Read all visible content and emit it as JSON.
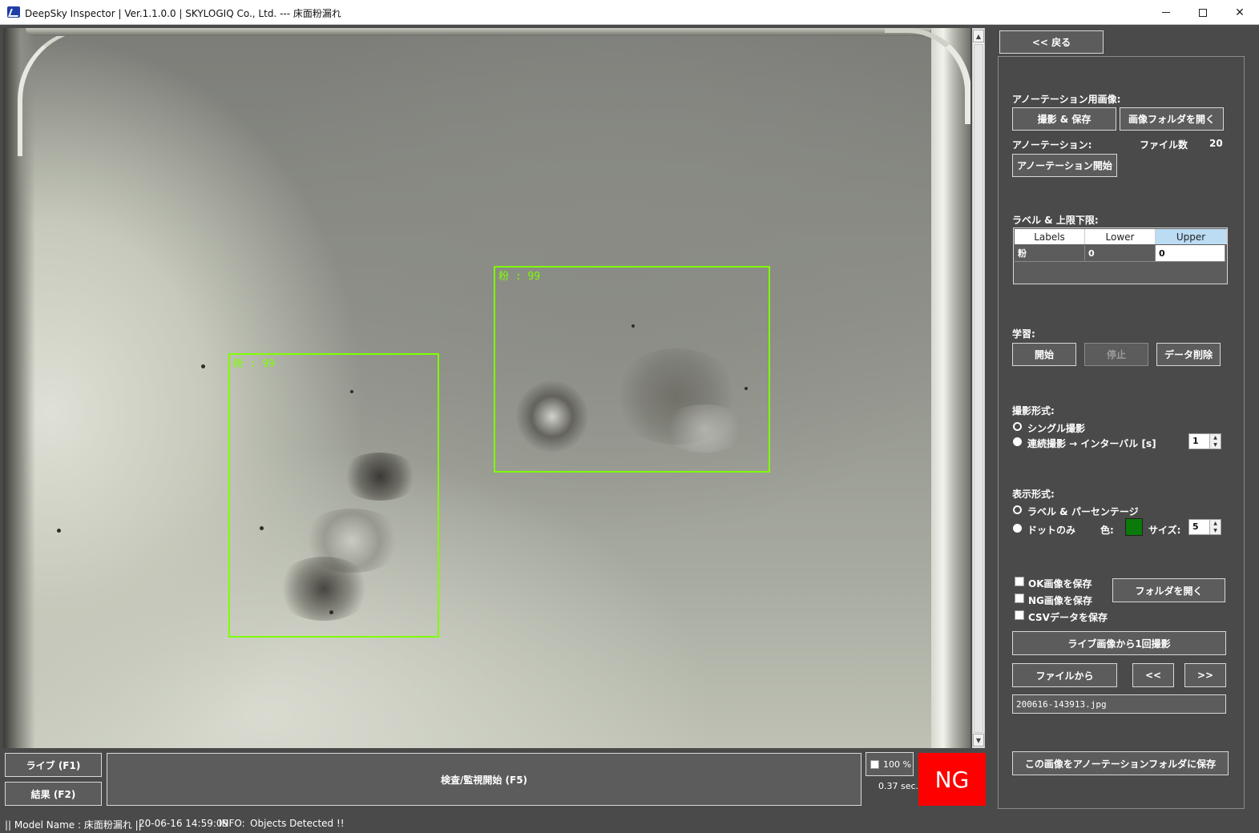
{
  "window": {
    "title": "DeepSky Inspector | Ver.1.1.0.0 | SKYLOGIQ Co., Ltd. --- 床面粉漏れ",
    "min_icon": "minimize-icon",
    "max_icon": "maximize-icon",
    "close_label": "✕"
  },
  "detections": [
    {
      "label": "粉 : 99"
    },
    {
      "label": "粉 : 99"
    }
  ],
  "bottom": {
    "live_label": "ライブ (F1)",
    "result_label": "結果 (F2)",
    "start_label": "検査/監視開始 (F5)",
    "percent_label": "100 %",
    "time_label": "0.37 sec.",
    "verdict": "NG",
    "verdict_color": "#ff0000"
  },
  "status": {
    "model": "|| Model Name : 床面粉漏れ ||",
    "timestamp": "20-06-16 14:59:09",
    "info_prefix": "INFO:",
    "info_message": "Objects Detected !!"
  },
  "panel": {
    "back_label": "<< 戻る",
    "annotation_images_label": "アノーテーション用画像:",
    "capture_save_label": "撮影 & 保存",
    "open_image_folder_label": "画像フォルダを開く",
    "annotation_label": "アノーテーション:",
    "file_count_label": "ファイル数",
    "file_count_value": "20",
    "annotation_start_label": "アノーテーション開始",
    "label_limits_label": "ラベル & 上限下限:",
    "grid": {
      "headers": [
        "Labels",
        "Lower",
        "Upper"
      ],
      "row": [
        "粉",
        "0",
        "0"
      ]
    },
    "learning_label": "学習:",
    "learn_start_label": "開始",
    "learn_stop_label": "停止",
    "data_delete_label": "データ削除",
    "capture_mode_label": "撮影形式:",
    "single_capture_label": "シングル撮影",
    "continuous_capture_label": "連続撮影 → インターバル [s]",
    "interval_value": "1",
    "display_mode_label": "表示形式:",
    "label_percentage_label": "ラベル & パーセンテージ",
    "dot_only_label": "ドットのみ",
    "color_label": "色:",
    "size_label": "サイズ:",
    "size_value": "5",
    "dot_color": "#0a7a0a",
    "save_ok_label": "OK画像を保存",
    "save_ng_label": "NG画像を保存",
    "save_csv_label": "CSVデータを保存",
    "open_folder_label": "フォルダを開く",
    "capture_from_live_label": "ライブ画像から1回撮影",
    "from_file_label": "ファイルから",
    "prev_label": "<<",
    "next_label": ">>",
    "filename_value": "200616-143913.jpg",
    "save_to_annotation_label": "この画像をアノーテーションフォルダに保存"
  }
}
